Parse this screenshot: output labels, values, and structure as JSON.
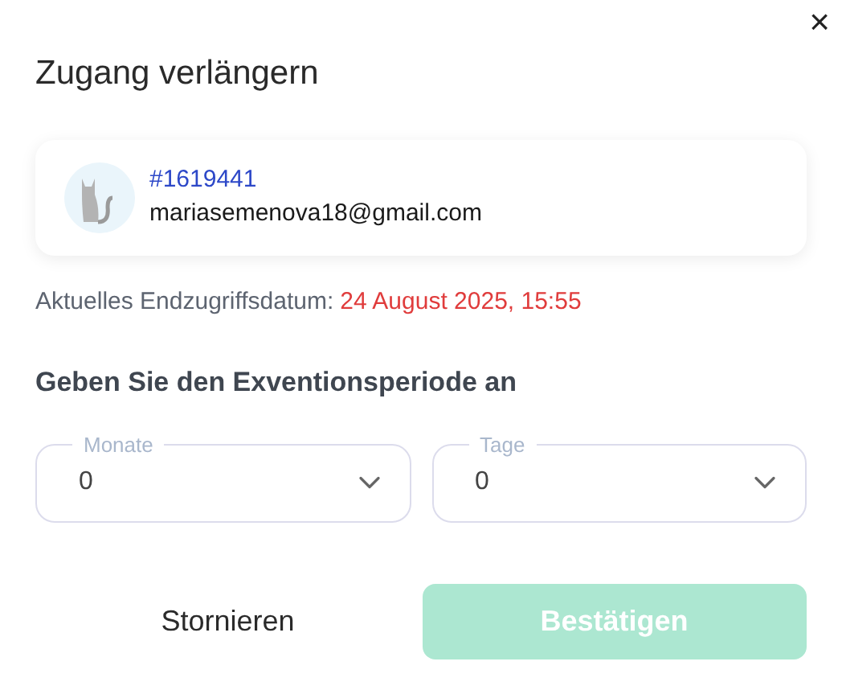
{
  "dialog": {
    "title": "Zugang verlängern",
    "close": "×"
  },
  "user": {
    "id": "#1619441",
    "email": "mariasemenova18@gmail.com"
  },
  "current_end": {
    "label": "Aktuelles Endzugriffsdatum:",
    "value": "24 August 2025, 15:55"
  },
  "period": {
    "heading": "Geben Sie den Exventionsperiode an",
    "fields": [
      {
        "label": "Monate",
        "value": "0"
      },
      {
        "label": "Tage",
        "value": "0"
      }
    ]
  },
  "buttons": {
    "cancel": "Stornieren",
    "confirm": {
      "label": "Bestätigen",
      "disabled": true
    }
  }
}
